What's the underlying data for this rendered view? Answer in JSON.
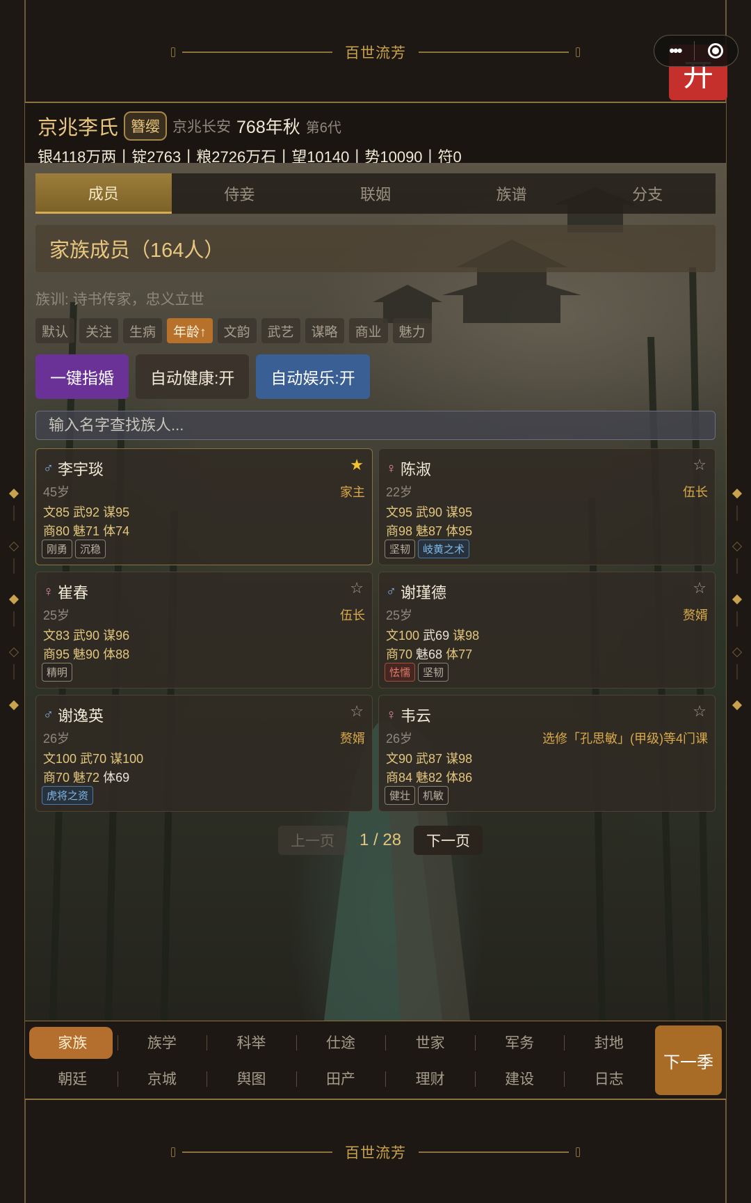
{
  "brand": {
    "title": "百世流芳"
  },
  "top_button": {
    "label": "开"
  },
  "header": {
    "clan_name": "京兆李氏",
    "rank_badge": "簪缨",
    "location": "京兆长安",
    "date": "768年秋",
    "generation": "第6代",
    "resources": "银4118万两丨锭2763丨粮2726万石丨望10140丨势10090丨符0"
  },
  "tabs": [
    {
      "label": "成员",
      "active": true
    },
    {
      "label": "侍妾",
      "active": false
    },
    {
      "label": "联姻",
      "active": false
    },
    {
      "label": "族谱",
      "active": false
    },
    {
      "label": "分支",
      "active": false
    }
  ],
  "section": {
    "title": "家族成员（164人）",
    "motto": "族训: 诗书传家，忠义立世"
  },
  "filters": [
    "默认",
    "关注",
    "生病",
    "年龄↑",
    "文韵",
    "武艺",
    "谋略",
    "商业",
    "魅力"
  ],
  "active_filter": "年龄↑",
  "actions": {
    "marry": "一键指婚",
    "auto_health": "自动健康:开",
    "auto_fun": "自动娱乐:开"
  },
  "search": {
    "placeholder": "输入名字查找族人..."
  },
  "members": [
    {
      "gender": "♂",
      "name": "李宇琰",
      "starred": true,
      "star": "★",
      "age": "45岁",
      "role": "家主",
      "line1": [
        {
          "t": "文85",
          "c": "y"
        },
        {
          "t": "武92",
          "c": "y"
        },
        {
          "t": "谋95",
          "c": "y"
        }
      ],
      "line2": [
        {
          "t": "商80",
          "c": "y"
        },
        {
          "t": "魅71",
          "c": "y"
        },
        {
          "t": "体74",
          "c": "y"
        }
      ],
      "traits": [
        {
          "label": "刚勇",
          "style": "gray"
        },
        {
          "label": "沉稳",
          "style": "gray"
        }
      ]
    },
    {
      "gender": "♀",
      "name": "陈淑",
      "starred": false,
      "star": "☆",
      "age": "22岁",
      "role": "伍长",
      "line1": [
        {
          "t": "文95",
          "c": "y"
        },
        {
          "t": "武90",
          "c": "y"
        },
        {
          "t": "谋95",
          "c": "y"
        }
      ],
      "line2": [
        {
          "t": "商98",
          "c": "y"
        },
        {
          "t": "魅87",
          "c": "y"
        },
        {
          "t": "体95",
          "c": "y"
        }
      ],
      "traits": [
        {
          "label": "坚韧",
          "style": "gray"
        },
        {
          "label": "岐黄之术",
          "style": "blue"
        }
      ]
    },
    {
      "gender": "♀",
      "name": "崔春",
      "starred": false,
      "star": "☆",
      "age": "25岁",
      "role": "伍长",
      "line1": [
        {
          "t": "文83",
          "c": "y"
        },
        {
          "t": "武90",
          "c": "y"
        },
        {
          "t": "谋96",
          "c": "y"
        }
      ],
      "line2": [
        {
          "t": "商95",
          "c": "y"
        },
        {
          "t": "魅90",
          "c": "y"
        },
        {
          "t": "体88",
          "c": "y"
        }
      ],
      "traits": [
        {
          "label": "精明",
          "style": "gray"
        }
      ]
    },
    {
      "gender": "♂",
      "name": "谢瑾德",
      "starred": false,
      "star": "☆",
      "age": "25岁",
      "role": "赘婿",
      "line1": [
        {
          "t": "文100",
          "c": "y"
        },
        {
          "t": "武69",
          "c": "w"
        },
        {
          "t": "谋98",
          "c": "y"
        }
      ],
      "line2": [
        {
          "t": "商70",
          "c": "y"
        },
        {
          "t": "魅68",
          "c": "w"
        },
        {
          "t": "体77",
          "c": "y"
        }
      ],
      "traits": [
        {
          "label": "怯懦",
          "style": "red"
        },
        {
          "label": "坚韧",
          "style": "gray"
        }
      ]
    },
    {
      "gender": "♂",
      "name": "谢逸英",
      "starred": false,
      "star": "☆",
      "age": "26岁",
      "role": "赘婿",
      "line1": [
        {
          "t": "文100",
          "c": "y"
        },
        {
          "t": "武70",
          "c": "y"
        },
        {
          "t": "谋100",
          "c": "y"
        }
      ],
      "line2": [
        {
          "t": "商70",
          "c": "y"
        },
        {
          "t": "魅72",
          "c": "y"
        },
        {
          "t": "体69",
          "c": "w"
        }
      ],
      "traits": [
        {
          "label": "虎将之资",
          "style": "blue"
        }
      ]
    },
    {
      "gender": "♀",
      "name": "韦云",
      "starred": false,
      "star": "☆",
      "age": "26岁",
      "role": "选修「孔思敏」(甲级)等4门课",
      "line1": [
        {
          "t": "文90",
          "c": "y"
        },
        {
          "t": "武87",
          "c": "y"
        },
        {
          "t": "谋98",
          "c": "y"
        }
      ],
      "line2": [
        {
          "t": "商84",
          "c": "y"
        },
        {
          "t": "魅82",
          "c": "y"
        },
        {
          "t": "体86",
          "c": "y"
        }
      ],
      "traits": [
        {
          "label": "健壮",
          "style": "gray"
        },
        {
          "label": "机敏",
          "style": "gray"
        }
      ]
    }
  ],
  "pager": {
    "prev": "上一页",
    "info": "1 / 28",
    "next": "下一页"
  },
  "nav_row1": [
    "家族",
    "族学",
    "科举",
    "仕途",
    "世家",
    "军务",
    "封地"
  ],
  "nav_row2": [
    "朝廷",
    "京城",
    "舆图",
    "田产",
    "理财",
    "建设",
    "日志"
  ],
  "nav_active": "家族",
  "next_season": "下一季"
}
